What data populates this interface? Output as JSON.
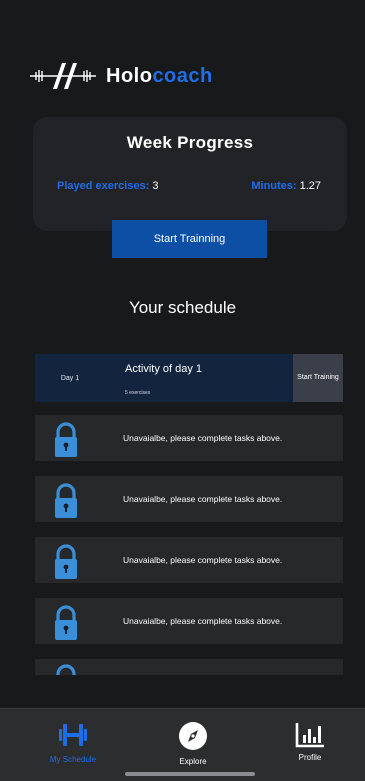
{
  "app": {
    "name_part1": "Holo",
    "name_part2": "coach"
  },
  "progress": {
    "title": "Week Progress",
    "played_label": "Played exercises:",
    "played_value": "3",
    "minutes_label": "Minutes:",
    "minutes_value": "1.27",
    "start_button": "Start Trainning"
  },
  "schedule": {
    "title": "Your schedule",
    "current": {
      "day": "Day 1",
      "activity": "Activity of day 1",
      "exercises": "5 exercises",
      "start_label": "Start Training"
    },
    "locked_message": "Unavaialbe, please complete tasks above."
  },
  "tabs": [
    {
      "label": "My Schedule",
      "icon": "dumbbell-icon",
      "active": true
    },
    {
      "label": "Explore",
      "icon": "compass-icon",
      "active": false
    },
    {
      "label": "Profile",
      "icon": "bar-chart-icon",
      "active": false
    }
  ],
  "colors": {
    "accent": "#1e6ee8",
    "button": "#0d4fa5",
    "lock": "#3a8fd8",
    "background": "#18191b"
  }
}
